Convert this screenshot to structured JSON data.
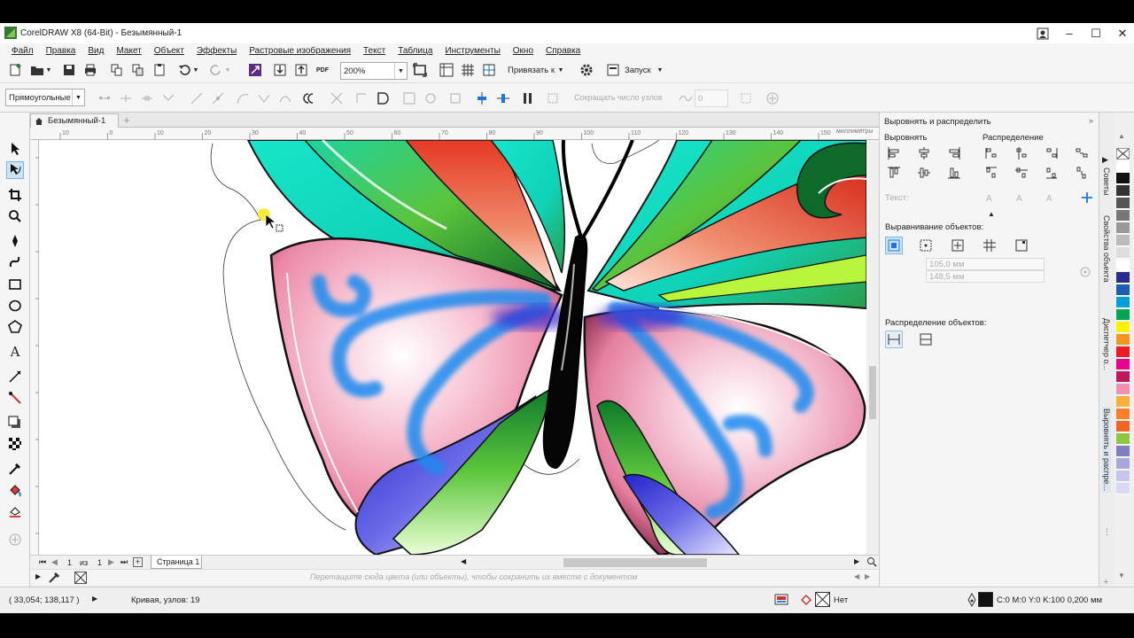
{
  "window": {
    "title": "CorelDRAW X8 (64-Bit) - Безымянный-1"
  },
  "menu": [
    "Файл",
    "Правка",
    "Вид",
    "Макет",
    "Объект",
    "Эффекты",
    "Растровые изображения",
    "Текст",
    "Таблица",
    "Инструменты",
    "Окно",
    "Справка"
  ],
  "toolbar": {
    "zoom_value": "200%",
    "snap_label": "Привязать к",
    "launch_label": "Запуск",
    "pdf_label": "PDF"
  },
  "propbar": {
    "shape_mode": "Прямоугольные",
    "node_count_label": "Сокращать число узлов",
    "smooth_value": "0"
  },
  "document": {
    "tab_label": "Безымянный-1",
    "ruler_units": "миллиметры",
    "hruler_ticks": [
      "10",
      "0",
      "10",
      "20",
      "30",
      "40",
      "50",
      "60",
      "70",
      "80",
      "90",
      "100",
      "110",
      "120",
      "130",
      "140",
      "150"
    ]
  },
  "pagebar": {
    "current": "1",
    "of_label": "из",
    "total": "1",
    "page_tab": "Страница 1"
  },
  "color_doc_hint": "Перетащите сюда цвета (или объекты), чтобы сохранить их вместе с документом",
  "docker": {
    "title": "Выровнять и распределить",
    "align_label": "Выровнять",
    "distribute_label": "Распределение",
    "text_label": "Текст:",
    "align_objects_label": "Выравнивание объектов:",
    "x_value": "105,0 мм",
    "y_value": "148,5 мм",
    "distribute_objects_label": "Распределение объектов:"
  },
  "dockertabs": [
    "Советы",
    "Свойства объекта",
    "Диспетчер о...",
    "Выровнять и распре..."
  ],
  "palette": [
    "#ffffff",
    "#111111",
    "#333333",
    "#555555",
    "#777777",
    "#999999",
    "#bbbbbb",
    "#dddddd",
    "#ffffff",
    "#2a2a8f",
    "#1a5fb4",
    "#00a0e0",
    "#00a651",
    "#fff200",
    "#f7941d",
    "#ed1c24",
    "#ec008c",
    "#c2185b",
    "#f48fb1",
    "#fbb03b",
    "#ff7f27",
    "#f26522",
    "#8dc63f",
    "#7f7fbf",
    "#a8a8e0",
    "#c5c5ee",
    "#d9d9f5"
  ],
  "status": {
    "coords": "( 33,054; 138,117 )",
    "object_info": "Кривая, узлов: 19",
    "fill_none": "Нет",
    "outline_info": "C:0 M:0 Y:0 K:100  0,200 мм"
  },
  "icons": {
    "app": "coreldraw-logo-icon",
    "fill_indicator": "no-fill-icon"
  }
}
